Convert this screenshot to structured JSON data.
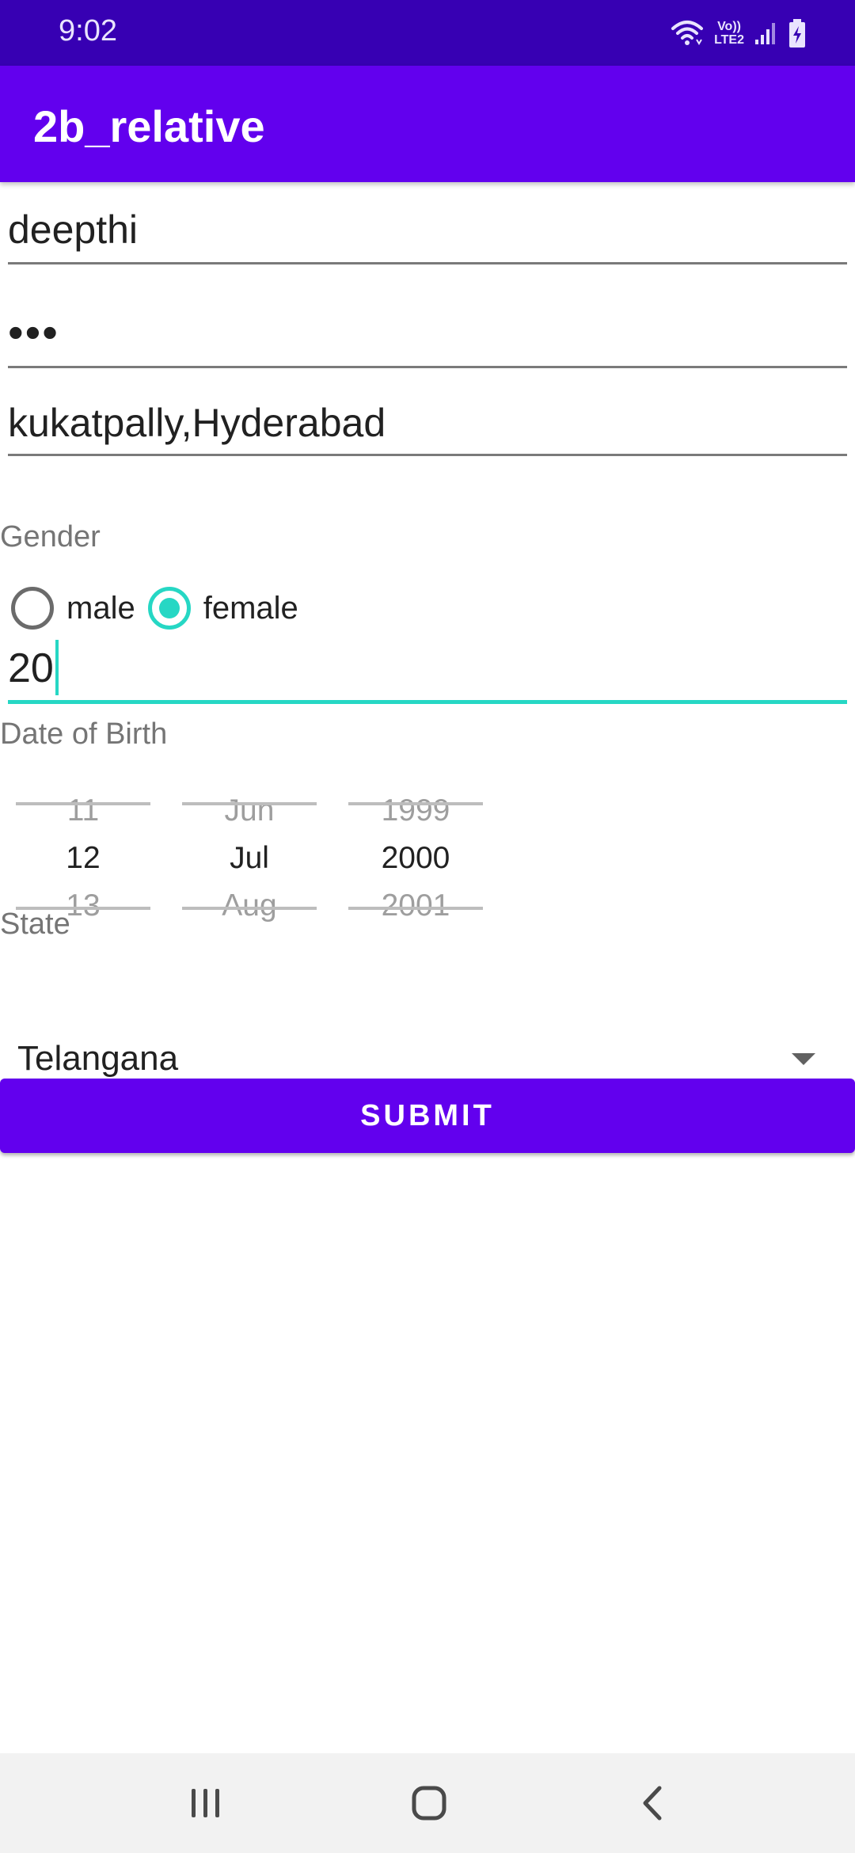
{
  "status_bar": {
    "time": "9:02",
    "network_line1": "Vo))",
    "network_line2": "LTE2",
    "icons": [
      "wifi-icon",
      "volte-lte-icon",
      "signal-icon",
      "battery-charging-icon"
    ]
  },
  "app_bar": {
    "title": "2b_relative"
  },
  "form": {
    "name_value": "deepthi",
    "password_value": "•••",
    "address_value": "kukatpally,Hyderabad",
    "gender_label": "Gender",
    "gender_options": [
      {
        "label": "male",
        "checked": false
      },
      {
        "label": "female",
        "checked": true
      }
    ],
    "age_value": "20",
    "dob_label": "Date of Birth",
    "dob": {
      "day": {
        "prev": "11",
        "current": "12",
        "next": "13"
      },
      "month": {
        "prev": "Jun",
        "current": "Jul",
        "next": "Aug"
      },
      "year": {
        "prev": "1999",
        "current": "2000",
        "next": "2001"
      }
    },
    "state_label": "State",
    "state_value": "Telangana",
    "submit_label": "SUBMIT"
  },
  "colors": {
    "primary": "#6200EE",
    "primary_dark": "#3700B3",
    "accent": "#26D7C4"
  },
  "nav_bar": {
    "icons": [
      "recent-apps-icon",
      "home-icon",
      "back-icon"
    ]
  }
}
